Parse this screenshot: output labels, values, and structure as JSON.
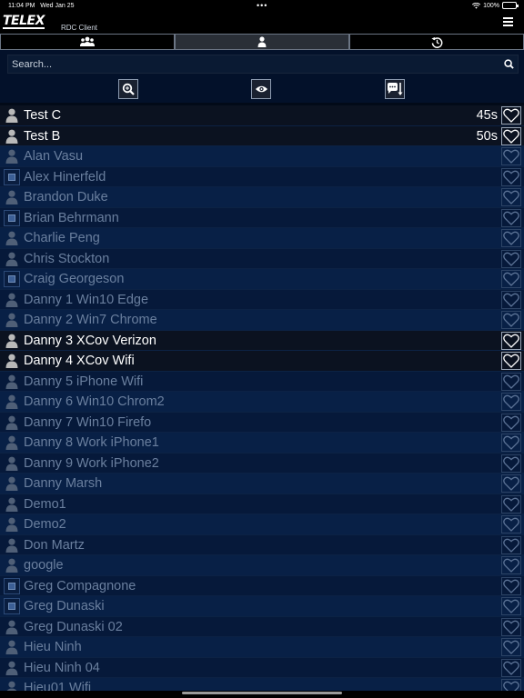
{
  "status_bar": {
    "time": "11:04 PM",
    "date": "Wed Jan 25",
    "battery": "100%",
    "battery_level": 1.0
  },
  "header": {
    "logo": "TELEX",
    "title": "RDC Client"
  },
  "tabs": [
    {
      "name": "tab-groups",
      "icon": "group-icon",
      "active": false
    },
    {
      "name": "tab-users",
      "icon": "user-icon",
      "active": true
    },
    {
      "name": "tab-history",
      "icon": "history-icon",
      "active": false
    }
  ],
  "search": {
    "placeholder": "Search..."
  },
  "actions": [
    "zoom-search-icon",
    "eye-icon",
    "message-sort-icon"
  ],
  "users": [
    {
      "name": "Test C",
      "type": "user",
      "online": true,
      "timer": "45s"
    },
    {
      "name": "Test B",
      "type": "user",
      "online": true,
      "timer": "50s"
    },
    {
      "name": "Alan Vasu",
      "type": "user",
      "online": false
    },
    {
      "name": "Alex Hinerfeld",
      "type": "station",
      "online": false
    },
    {
      "name": "Brandon Duke",
      "type": "user",
      "online": false
    },
    {
      "name": "Brian Behrmann",
      "type": "station",
      "online": false
    },
    {
      "name": "Charlie Peng",
      "type": "user",
      "online": false
    },
    {
      "name": "Chris Stockton",
      "type": "user",
      "online": false
    },
    {
      "name": "Craig Georgeson",
      "type": "station",
      "online": false
    },
    {
      "name": "Danny 1 Win10 Edge",
      "type": "user",
      "online": false
    },
    {
      "name": "Danny 2 Win7 Chrome",
      "type": "user",
      "online": false
    },
    {
      "name": "Danny 3 XCov Verizon",
      "type": "user",
      "online": true
    },
    {
      "name": "Danny 4 XCov Wifi",
      "type": "user",
      "online": true
    },
    {
      "name": "Danny 5 iPhone Wifi",
      "type": "user",
      "online": false
    },
    {
      "name": "Danny 6 Win10 Chrom2",
      "type": "user",
      "online": false
    },
    {
      "name": "Danny 7 Win10 Firefo",
      "type": "user",
      "online": false
    },
    {
      "name": "Danny 8 Work iPhone1",
      "type": "user",
      "online": false
    },
    {
      "name": "Danny 9 Work iPhone2",
      "type": "user",
      "online": false
    },
    {
      "name": "Danny Marsh",
      "type": "user",
      "online": false
    },
    {
      "name": "Demo1",
      "type": "user",
      "online": false
    },
    {
      "name": "Demo2",
      "type": "user",
      "online": false
    },
    {
      "name": "Don Martz",
      "type": "user",
      "online": false
    },
    {
      "name": "google",
      "type": "user",
      "online": false
    },
    {
      "name": "Greg Compagnone",
      "type": "station",
      "online": false
    },
    {
      "name": "Greg Dunaski",
      "type": "station",
      "online": false
    },
    {
      "name": "Greg Dunaski 02",
      "type": "user",
      "online": false
    },
    {
      "name": "Hieu Ninh",
      "type": "user",
      "online": false
    },
    {
      "name": "Hieu Ninh 04",
      "type": "user",
      "online": false
    },
    {
      "name": "Hieu01 Wifi",
      "type": "user",
      "online": false
    }
  ]
}
